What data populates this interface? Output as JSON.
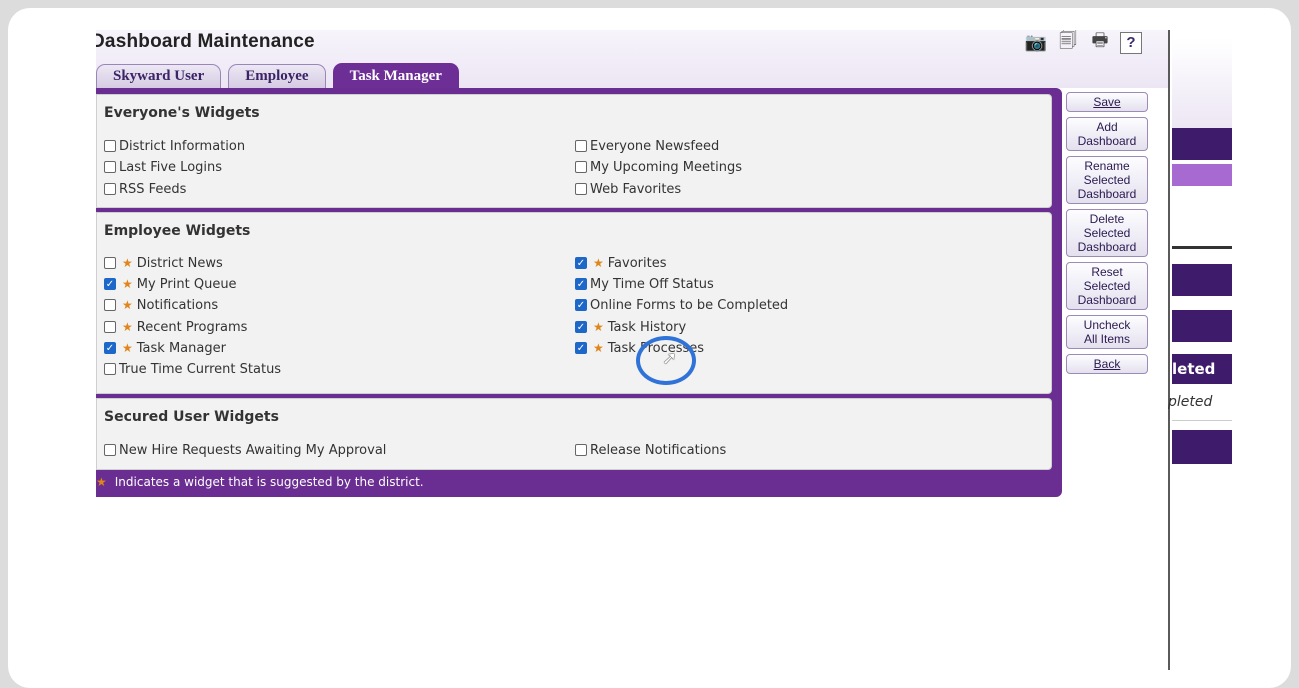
{
  "header": {
    "title": "Dashboard Maintenance",
    "tools": [
      {
        "icon": "camera-icon",
        "glyph": "📷"
      },
      {
        "icon": "export-icon",
        "glyph": "🗐"
      },
      {
        "icon": "print-icon",
        "glyph": "🖶"
      },
      {
        "icon": "help-icon",
        "glyph": "?"
      }
    ]
  },
  "tabs": [
    {
      "label": "Skyward User",
      "active": false
    },
    {
      "label": "Employee",
      "active": false
    },
    {
      "label": "Task Manager",
      "active": true
    }
  ],
  "sections": {
    "everyone": {
      "title": "Everyone's Widgets",
      "left": [
        {
          "label": "District Information",
          "checked": false,
          "star": false
        },
        {
          "label": "Last Five Logins",
          "checked": false,
          "star": false
        },
        {
          "label": "RSS Feeds",
          "checked": false,
          "star": false
        }
      ],
      "right": [
        {
          "label": "Everyone Newsfeed",
          "checked": false,
          "star": false
        },
        {
          "label": "My Upcoming Meetings",
          "checked": false,
          "star": false
        },
        {
          "label": "Web Favorites",
          "checked": false,
          "star": false
        }
      ]
    },
    "employee": {
      "title": "Employee Widgets",
      "left": [
        {
          "label": "District News",
          "checked": false,
          "star": true
        },
        {
          "label": "My Print Queue",
          "checked": true,
          "star": true
        },
        {
          "label": "Notifications",
          "checked": false,
          "star": true
        },
        {
          "label": "Recent Programs",
          "checked": false,
          "star": true
        },
        {
          "label": "Task Manager",
          "checked": true,
          "star": true
        },
        {
          "label": "True Time Current Status",
          "checked": false,
          "star": false
        }
      ],
      "right": [
        {
          "label": "Favorites",
          "checked": true,
          "star": true
        },
        {
          "label": "My Time Off Status",
          "checked": true,
          "star": false
        },
        {
          "label": "Online Forms to be Completed",
          "checked": true,
          "star": false
        },
        {
          "label": "Task History",
          "checked": true,
          "star": true
        },
        {
          "label": "Task Processes",
          "checked": true,
          "star": true
        }
      ]
    },
    "secured": {
      "title": "Secured User Widgets",
      "left": [
        {
          "label": "New Hire Requests Awaiting My Approval",
          "checked": false,
          "star": false
        }
      ],
      "right": [
        {
          "label": "Release Notifications",
          "checked": false,
          "star": false
        }
      ]
    }
  },
  "footer_note": "Indicates a widget that is suggested by the district.",
  "side_buttons": {
    "save": "Save",
    "add": "Add Dashboard",
    "rename": "Rename Selected Dashboard",
    "delete": "Delete Selected Dashboard",
    "reset": "Reset Selected Dashboard",
    "uncheck": "Uncheck All Items",
    "back": "Back"
  },
  "right_panel": {
    "bar_text": "leted",
    "italic_text": "pleted"
  },
  "colors": {
    "accent": "#6d2f96",
    "dark_bar": "#3f1c6b",
    "light_bar": "#a66ad0",
    "checkbox_on": "#1d67c9",
    "star": "#e0851a",
    "cursor_ring": "#2f73d9"
  }
}
